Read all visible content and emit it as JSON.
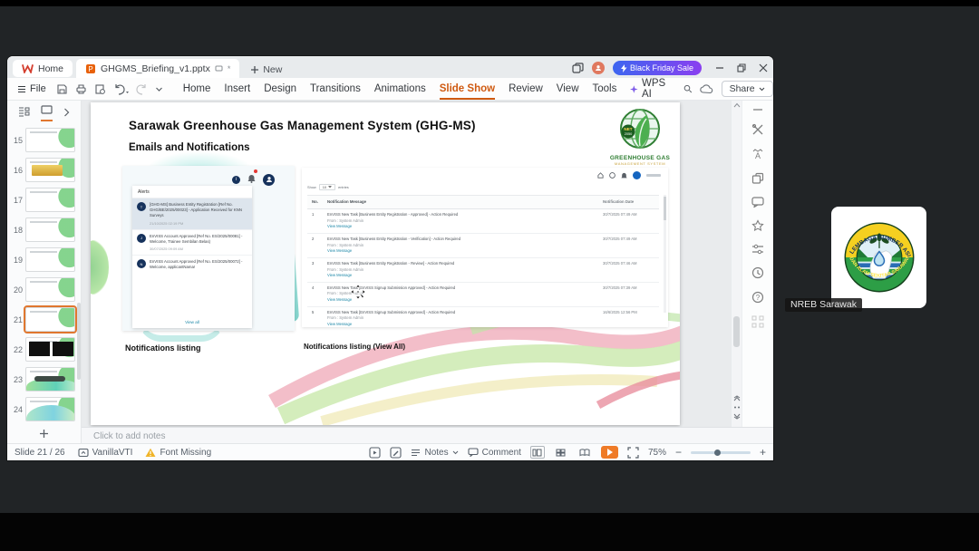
{
  "titlebar": {
    "home_label": "Home",
    "doc_title": "GHGMS_Briefing_v1.pptx",
    "unsaved_marker": "*",
    "new_label": "New",
    "promo_label": "Black Friday Sale"
  },
  "menubar": {
    "file_label": "File",
    "items": [
      "Home",
      "Insert",
      "Design",
      "Transitions",
      "Animations",
      "Slide Show",
      "Review",
      "View",
      "Tools"
    ],
    "active_item": "Slide Show",
    "wps_ai_label": "WPS AI",
    "share_label": "Share"
  },
  "panel": {
    "slides": [
      15,
      16,
      17,
      18,
      19,
      20,
      21,
      22,
      23,
      24
    ],
    "selected": 21
  },
  "slide": {
    "title": "Sarawak Greenhouse Gas Management System (GHG-MS)",
    "subtitle": "Emails and Notifications",
    "logo": {
      "badge1": "NET",
      "badge2": "2050",
      "line1": "GREENHOUSE GAS",
      "line2": "MANAGEMENT SYSTEM"
    },
    "alerts": {
      "header": "Alerts",
      "view_all": "View all",
      "items": [
        {
          "initial": "T",
          "text": "[GHG-MS] Business Entity Registration [Ref No. GHG/BE/2025/00023] - Application Received for KNN Surveys",
          "time": "21/10/2025 02:19 PM"
        },
        {
          "initial": "J",
          "text": "EnVISS Account Approved [Ref No. ES/2025/00081] - Welcome, Trainee Sembilan Belas)",
          "time": "30/07/2025 09:09 AM"
        },
        {
          "initial": "N",
          "text": "EnVISS Account Approved [Ref No. ES/2025/00072] - Welcome, applicantNama!",
          "time": ""
        }
      ]
    },
    "table": {
      "show_prefix": "Show",
      "show_value": "10",
      "show_suffix": "entries",
      "columns": [
        "No.",
        "Notification Message",
        "Notification Date"
      ],
      "rows": [
        {
          "no": "1",
          "message": "EnVISS New Task [Business Entity Registration - Approved] - Action Required",
          "from": "From : System Admin",
          "link": "View Message",
          "date": "30/7/2025 07:49 AM"
        },
        {
          "no": "2",
          "message": "EnVISS New Task [Business Entity Registration - Verification] - Action Required",
          "from": "From : System Admin",
          "link": "View Message",
          "date": "30/7/2025 07:49 AM"
        },
        {
          "no": "3",
          "message": "EnVISS New Task [Business Entity Registration - Review] - Action Required",
          "from": "From : System Admin",
          "link": "View Message",
          "date": "30/7/2025 07:46 AM"
        },
        {
          "no": "4",
          "message": "EnVISS New Task [EnVISS Signup Submission Approved] - Action Required",
          "from": "From : System Admin",
          "link": "View Message",
          "date": "30/7/2025 07:39 AM"
        },
        {
          "no": "5",
          "message": "EnVISS New Task [EnVISS Signup Submission Approved] - Action Required",
          "from": "From : System Admin",
          "link": "View Message",
          "date": "16/6/2025 12:56 PM"
        }
      ]
    },
    "captions": {
      "left": "Notifications listing",
      "right": "Notifications listing (View All)"
    }
  },
  "notes": {
    "placeholder": "Click to add notes"
  },
  "statusbar": {
    "slide_counter": "Slide 21 / 26",
    "theme_name": "VanillaVTI",
    "font_missing": "Font Missing",
    "notes_label": "Notes",
    "comment_label": "Comment",
    "zoom_value": "75%"
  },
  "participant": {
    "name": "NREB Sarawak",
    "logo_arc_top": "LEMBAGA SUMBER ASLI",
    "logo_arc_bottom": "DAN ALAM SEKITAR SARAWAK"
  },
  "colors": {
    "accent_orange": "#cf5a11",
    "promo_gradient_start": "#3d66f0",
    "promo_gradient_end": "#8a3ff0",
    "link_teal": "#1e88a8",
    "play_orange": "#ef7b27"
  }
}
